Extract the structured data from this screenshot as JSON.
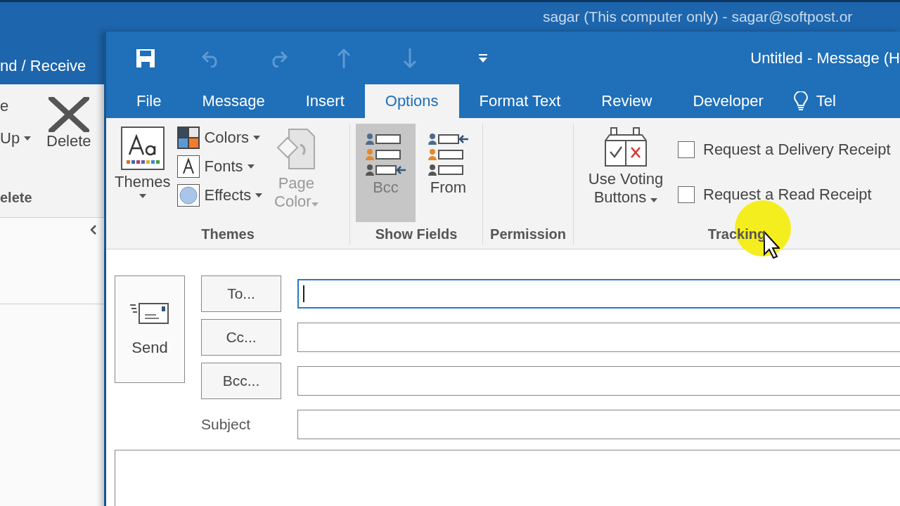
{
  "back_window": {
    "account": "sagar (This computer only) - sagar@softpost.or",
    "send_receive_tab": "nd / Receive",
    "ribbon_item": "e",
    "up_button": "Up",
    "delete_button": "Delete",
    "group_label": "elete"
  },
  "message_window": {
    "title": "Untitled - Message (H",
    "quick_access": [
      {
        "kind": "save",
        "disabled": false
      },
      {
        "kind": "undo",
        "disabled": true
      },
      {
        "kind": "redo",
        "disabled": true
      },
      {
        "kind": "up",
        "disabled": true
      },
      {
        "kind": "down",
        "disabled": true
      },
      {
        "kind": "customize",
        "disabled": false
      }
    ],
    "tabs": [
      {
        "label": "File",
        "selected": false
      },
      {
        "label": "Message",
        "selected": false
      },
      {
        "label": "Insert",
        "selected": false
      },
      {
        "label": "Options",
        "selected": true
      },
      {
        "label": "Format Text",
        "selected": false
      },
      {
        "label": "Review",
        "selected": false
      },
      {
        "label": "Developer",
        "selected": false
      }
    ],
    "tell_me": "Tel",
    "themes_group": {
      "label": "Themes",
      "themes_button": "Themes",
      "items": [
        {
          "kind": "colors",
          "label": "Colors"
        },
        {
          "kind": "fonts",
          "label": "Fonts"
        },
        {
          "kind": "effects",
          "label": "Effects"
        }
      ],
      "page_color": {
        "label": "Page Color",
        "disabled": true
      }
    },
    "show_fields_group": {
      "label": "Show Fields",
      "buttons": [
        {
          "kind": "bcc",
          "label": "Bcc",
          "selected": true
        },
        {
          "kind": "from",
          "label": "From",
          "selected": false
        }
      ]
    },
    "permission_group": {
      "label": "Permission"
    },
    "tracking_group": {
      "label": "Tracking",
      "voting_button": "Use Voting Buttons",
      "checkboxes": [
        {
          "label": "Request a Delivery Receipt",
          "checked": false
        },
        {
          "label": "Request a Read Receipt",
          "checked": false
        }
      ]
    },
    "send_button": "Send",
    "address_fields": [
      {
        "button": "To...",
        "focused": true
      },
      {
        "button": "Cc...",
        "focused": false
      },
      {
        "button": "Bcc...",
        "focused": false
      }
    ],
    "subject": {
      "label": "Subject",
      "focused": false
    }
  }
}
